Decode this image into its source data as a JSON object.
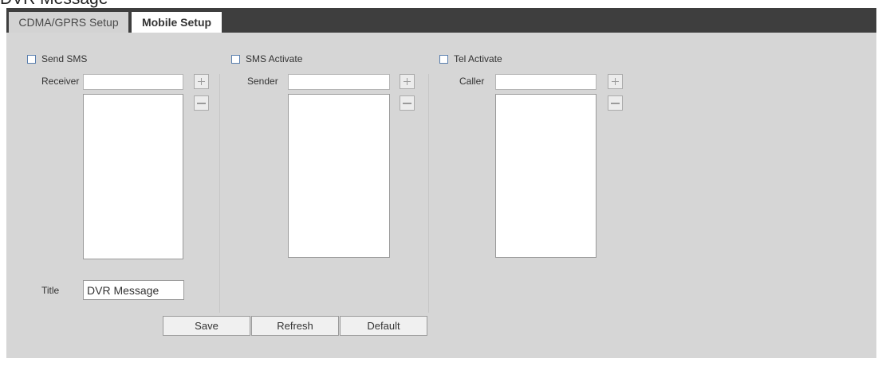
{
  "caption_fragment": "DVR Message",
  "tabs": [
    {
      "label": "CDMA/GPRS Setup",
      "active": false
    },
    {
      "label": "Mobile Setup",
      "active": true
    }
  ],
  "sms": {
    "enable_label": "Send SMS",
    "receiver_label": "Receiver",
    "receiver_value": "",
    "receivers": [],
    "title_label": "Title",
    "title_value": "DVR Message"
  },
  "sms_activate": {
    "enable_label": "SMS Activate",
    "sender_label": "Sender",
    "sender_value": "",
    "senders": []
  },
  "tel_activate": {
    "enable_label": "Tel Activate",
    "caller_label": "Caller",
    "caller_value": "",
    "callers": []
  },
  "actions": {
    "save": "Save",
    "refresh": "Refresh",
    "default": "Default"
  },
  "colors": {
    "tab_bar": "#3e3e3e",
    "panel": "#d6d6d6",
    "checkbox_border": "#5a7fae"
  }
}
